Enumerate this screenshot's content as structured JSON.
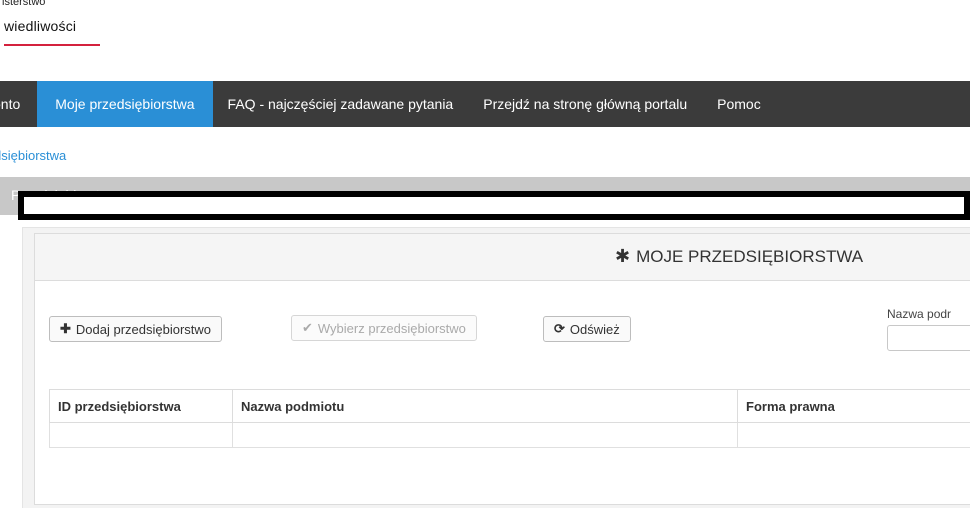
{
  "header": {
    "logo_line1": "isterstwo",
    "logo_line2": "wiedliwości"
  },
  "nav": {
    "items": [
      {
        "label": "onto"
      },
      {
        "label": "Moje przedsiębiorstwa",
        "active": true
      },
      {
        "label": "FAQ - najczęściej zadawane pytania"
      },
      {
        "label": "Przejdź na stronę główną portalu"
      },
      {
        "label": "Pomoc"
      }
    ]
  },
  "breadcrumb": "dsiębiorstwa",
  "page_title": "Przedsiębiorstwa",
  "panel": {
    "title": "MOJE PRZEDSIĘBIORSTWA",
    "title_icon": "asterisk-icon"
  },
  "toolbar": {
    "add_label": "Dodaj przedsiębiorstwo",
    "select_label": "Wybierz przedsiębiorstwo",
    "refresh_label": "Odśwież"
  },
  "search": {
    "label": "Nazwa podr",
    "value": ""
  },
  "table": {
    "columns": [
      "ID przedsiębiorstwa",
      "Nazwa podmiotu",
      "Forma prawna"
    ]
  },
  "colors": {
    "nav_bg": "#3b3b3b",
    "nav_active": "#2a8fd6",
    "link": "#2a8fd6",
    "title_bar": "#c8c8c8",
    "brand_red": "#d4213d"
  }
}
